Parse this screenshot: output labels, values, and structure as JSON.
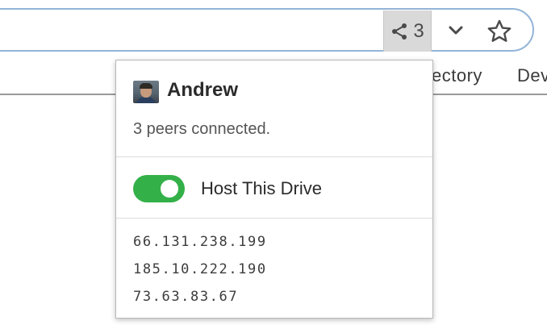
{
  "toolbar": {
    "peer_count": "3",
    "share_icon": "share-icon",
    "chevron_icon": "chevron-down-icon",
    "star_icon": "star-icon"
  },
  "background_nav": {
    "links": [
      "ectory",
      "Dev"
    ]
  },
  "popover": {
    "user": {
      "name": "Andrew",
      "avatar_icon": "avatar"
    },
    "status": "3 peers connected.",
    "host_toggle": {
      "label": "Host This Drive",
      "checked": true,
      "on_color": "#34b048"
    },
    "peers": [
      "66.131.238.199",
      "185.10.222.190",
      "73.63.83.67"
    ]
  },
  "colors": {
    "url_bar_border": "#93b4d7",
    "share_button_bg": "#d9d9d9",
    "toggle_on": "#34b048"
  }
}
